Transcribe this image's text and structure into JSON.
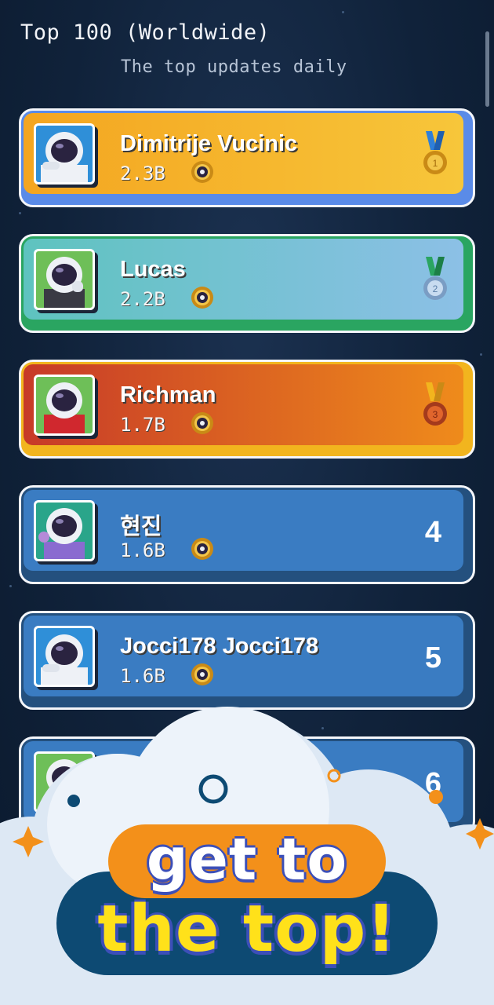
{
  "header": {
    "title": "Top 100 (Worldwide)",
    "subtitle": "The top updates daily"
  },
  "leaderboard": [
    {
      "name": "Dimitrije Vucinic",
      "score": "2.3B",
      "medal": "gold-medal-icon",
      "rank": "1",
      "style": "gold"
    },
    {
      "name": "Lucas",
      "score": "2.2B",
      "medal": "silver-medal-icon",
      "rank": "2",
      "style": "silver"
    },
    {
      "name": "Richman",
      "score": "1.7B",
      "medal": "bronze-medal-icon",
      "rank": "3",
      "style": "bronze"
    },
    {
      "name": "현진",
      "score": "1.6B",
      "rank": "4",
      "style": "plain"
    },
    {
      "name": "Jocci178 Jocci178",
      "score": "1.6B",
      "rank": "5",
      "style": "plain"
    },
    {
      "name": "",
      "score": "",
      "rank": "6",
      "style": "plain"
    }
  ],
  "promo": {
    "line1": "get to",
    "line2": "the top!"
  },
  "colors": {
    "background": "#10223a",
    "gold": "#f4a520",
    "silver": "#8cc0e6",
    "bronze": "#ef8b1b",
    "plain": "#3a7cc2",
    "cta_orange": "#f3901a",
    "cta_navy": "#0d4a73",
    "cta_yellow": "#ffe11a"
  }
}
